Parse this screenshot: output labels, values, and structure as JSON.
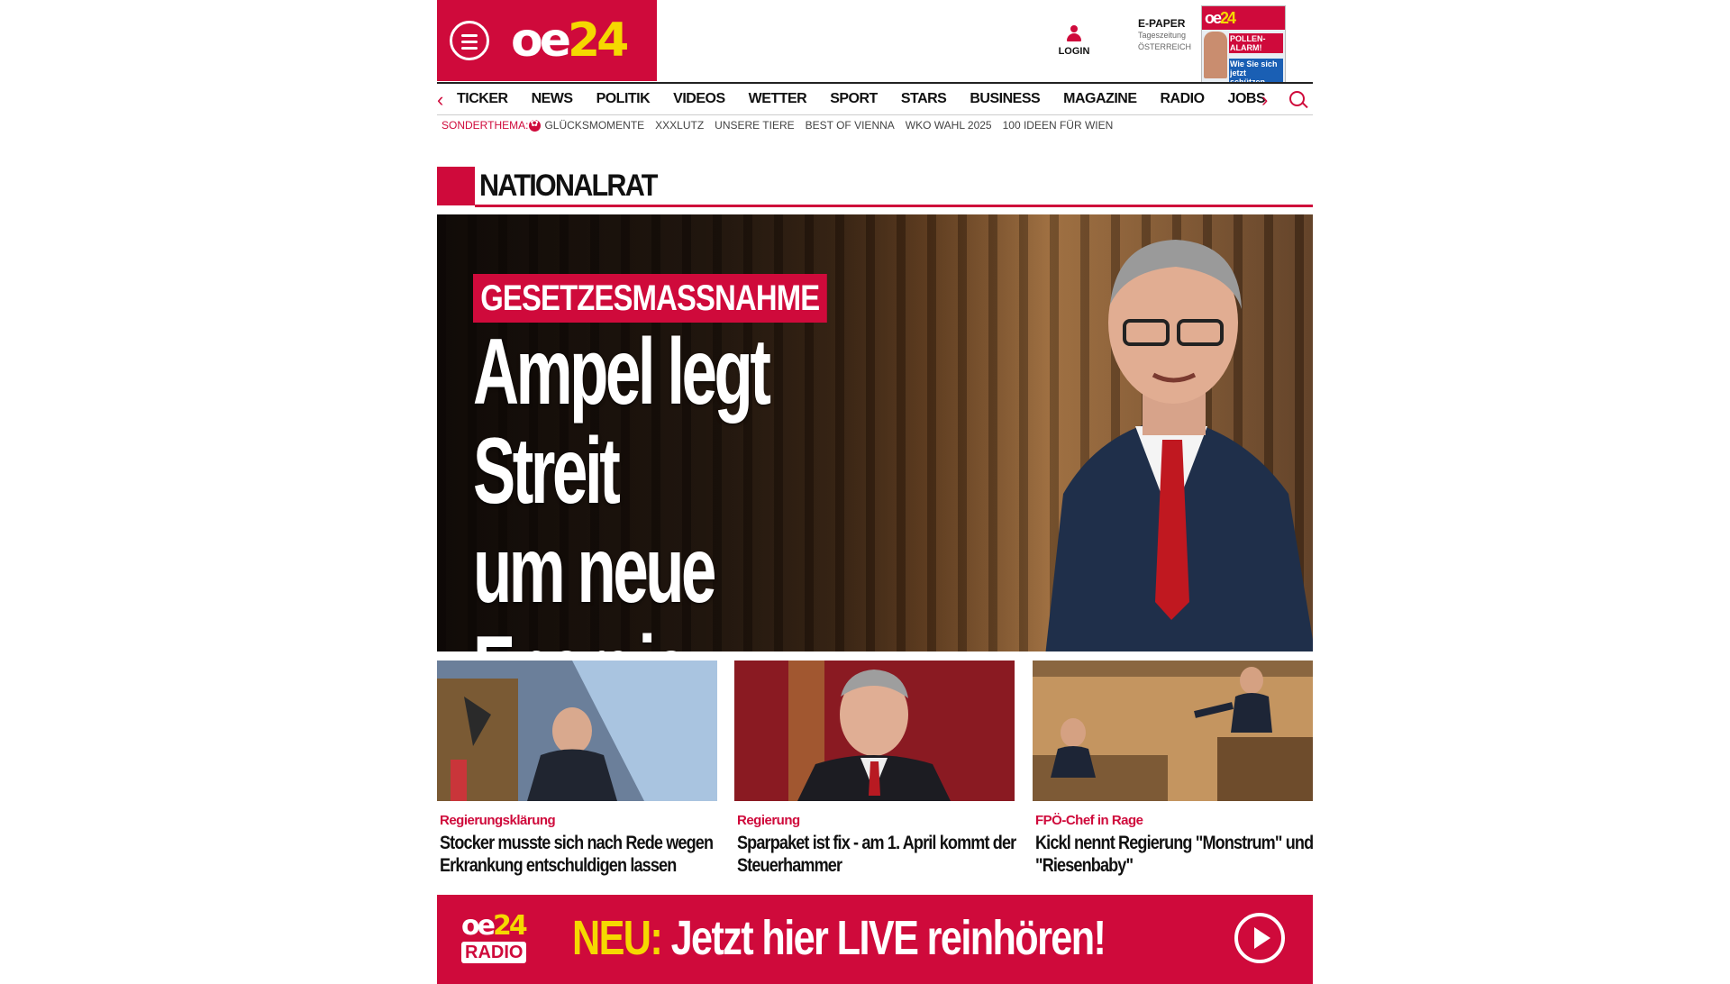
{
  "header": {
    "logo_oe": "oe",
    "logo_24": "24",
    "login_label": "LOGIN",
    "epaper": {
      "title": "E-PAPER",
      "line2": "Tageszeitung",
      "line3": "ÖSTERREICH"
    },
    "cover": {
      "logo_oe": "oe",
      "logo_24": "24",
      "headline1": "POLLEN-ALARM!",
      "headline2": "Wie Sie sich jetzt schützen"
    }
  },
  "nav": {
    "items": [
      "TICKER",
      "NEWS",
      "POLITIK",
      "VIDEOS",
      "WETTER",
      "SPORT",
      "STARS",
      "BUSINESS",
      "MAGAZINE",
      "RADIO",
      "JOBS"
    ],
    "prev": "‹",
    "next": "›"
  },
  "subnav": {
    "label": "SONDERTHEMA:",
    "items": [
      "GLÜCKSMOMENTE",
      "XXXLUTZ",
      "UNSERE TIERE",
      "BEST OF VIENNA",
      "WKO WAHL 2025",
      "100 IDEEN FÜR WIEN"
    ]
  },
  "section": {
    "title": "NATIONALRAT"
  },
  "hero": {
    "topic": "GESETZESMASSNAHME",
    "headline": "Ampel legt Streit\num neue Energie-\nGewinnsteuer bei"
  },
  "teasers": [
    {
      "kicker": "Regierungsklärung",
      "title": "Stocker musste sich nach Rede wegen Erkrankung entschuldigen lassen"
    },
    {
      "kicker": "Regierung",
      "title": "Sparpaket ist fix - am 1. April kommt der Steuerhammer"
    },
    {
      "kicker": "FPÖ-Chef in Rage",
      "title": "Kickl nennt Regierung \"Monstrum\" und \"Riesenbaby\""
    }
  ],
  "radio_banner": {
    "logo_oe": "oe",
    "logo_24": "24",
    "logo_radio": "RADIO",
    "neu": "NEU:",
    "text": " Jetzt hier LIVE reinhören!"
  },
  "colors": {
    "brand_red": "#cf0a3b",
    "brand_yellow": "#f5d800"
  },
  "icons": [
    "menu-icon",
    "user-icon",
    "search-icon",
    "chevron-left-icon",
    "chevron-right-icon",
    "flower-icon",
    "play-icon"
  ]
}
